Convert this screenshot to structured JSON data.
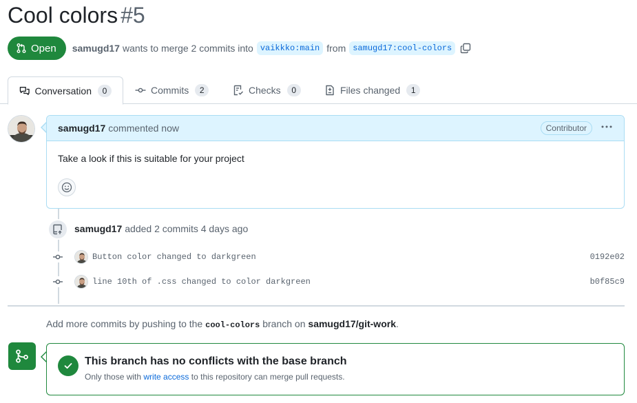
{
  "header": {
    "title": "Cool colors",
    "number": "#5",
    "state": "Open",
    "author": "samugd17",
    "merge_text": "wants to merge 2 commits into",
    "base_branch": "vaikkko:main",
    "from_text": "from",
    "head_branch": "samugd17:cool-colors"
  },
  "tabs": [
    {
      "label": "Conversation",
      "count": "0",
      "icon": "comment-discussion-icon"
    },
    {
      "label": "Commits",
      "count": "2",
      "icon": "git-commit-icon"
    },
    {
      "label": "Checks",
      "count": "0",
      "icon": "checklist-icon"
    },
    {
      "label": "Files changed",
      "count": "1",
      "icon": "file-diff-icon"
    }
  ],
  "comment": {
    "author": "samugd17",
    "action": "commented now",
    "role": "Contributor",
    "body": "Take a look if this is suitable for your project"
  },
  "push_event": {
    "author": "samugd17",
    "text": "added 2 commits 4 days ago"
  },
  "commits": [
    {
      "message": "Button color changed to darkgreen",
      "sha": "0192e02"
    },
    {
      "message": "line 10th of .css changed to color darkgreen",
      "sha": "b0f85c9"
    }
  ],
  "hint": {
    "prefix": "Add more commits by pushing to the",
    "branch": "cool-colors",
    "middle": "branch on",
    "repo": "samugd17/git-work",
    "suffix": "."
  },
  "merge": {
    "title": "This branch has no conflicts with the base branch",
    "sub_prefix": "Only those with",
    "sub_link": "write access",
    "sub_suffix": "to this repository can merge pull requests."
  },
  "colors": {
    "open_green": "#1f883d",
    "link_blue": "#0969da",
    "comment_header_bg": "#ddf4ff",
    "comment_border": "#aadcf3"
  }
}
